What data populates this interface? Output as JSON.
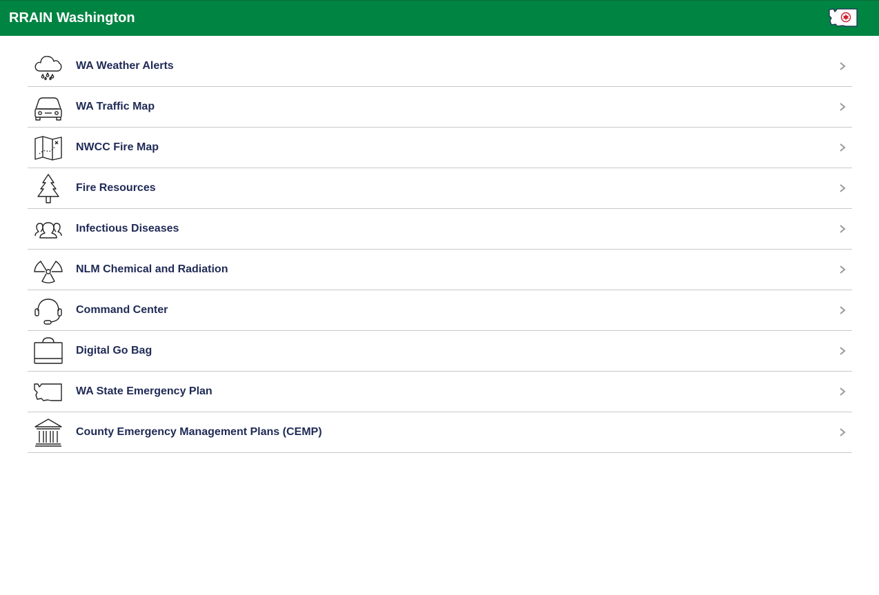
{
  "header": {
    "title": "RRAIN Washington",
    "bg_color": "#008442",
    "logo_icon": "washington-state-logo-icon"
  },
  "menu": {
    "label_color": "#1f2a55",
    "items": [
      {
        "label": "WA Weather Alerts",
        "icon": "rain-cloud-icon"
      },
      {
        "label": "WA Traffic Map",
        "icon": "car-icon"
      },
      {
        "label": "NWCC Fire Map",
        "icon": "folded-map-icon"
      },
      {
        "label": "Fire Resources",
        "icon": "pine-tree-icon"
      },
      {
        "label": "Infectious Diseases",
        "icon": "people-group-icon"
      },
      {
        "label": "NLM Chemical and Radiation",
        "icon": "radiation-icon"
      },
      {
        "label": "Command Center",
        "icon": "headset-icon"
      },
      {
        "label": "Digital Go Bag",
        "icon": "bag-icon"
      },
      {
        "label": "WA State Emergency Plan",
        "icon": "washington-state-outline-icon"
      },
      {
        "label": "County Emergency Management Plans (CEMP)",
        "icon": "government-building-icon"
      }
    ]
  }
}
